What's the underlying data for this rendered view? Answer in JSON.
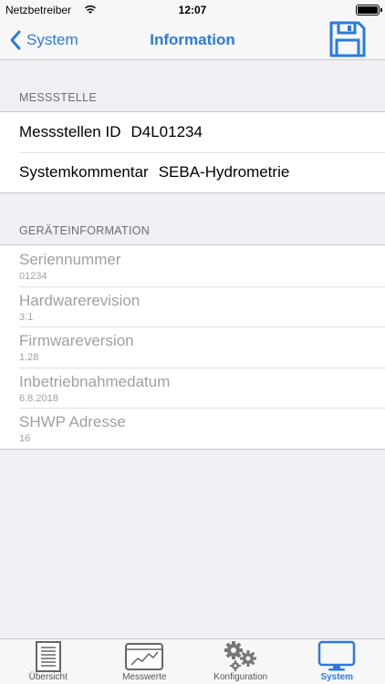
{
  "status_bar": {
    "carrier": "Netzbetreiber",
    "time": "12:07"
  },
  "nav": {
    "back_label": "System",
    "title": "Information",
    "save_icon": "floppy-disk-icon"
  },
  "sections": {
    "messstelle": {
      "header": "MESSSTELLE",
      "rows": [
        {
          "label": "Messstellen ID",
          "value": "D4L01234"
        },
        {
          "label": "Systemkommentar",
          "value": "SEBA-Hydrometrie"
        }
      ]
    },
    "geraeteinfo": {
      "header": "GERÄTEINFORMATION",
      "rows": [
        {
          "title": "Seriennummer",
          "value": "01234"
        },
        {
          "title": "Hardwarerevision",
          "value": "3.1"
        },
        {
          "title": "Firmwareversion",
          "value": "1.28"
        },
        {
          "title": "Inbetriebnahmedatum",
          "value": "6.8.2018"
        },
        {
          "title": "SHWP Adresse",
          "value": "16"
        }
      ]
    }
  },
  "tab_bar": {
    "tabs": [
      {
        "label": "Übersicht",
        "icon": "document-icon",
        "active": false
      },
      {
        "label": "Messwerte",
        "icon": "chart-icon",
        "active": false
      },
      {
        "label": "Konfiguration",
        "icon": "gears-icon",
        "active": false
      },
      {
        "label": "System",
        "icon": "monitor-icon",
        "active": true
      }
    ]
  },
  "colors": {
    "accent": "#2b7ae0",
    "background": "#efeff4",
    "secondary_text": "#a0a0a0"
  }
}
